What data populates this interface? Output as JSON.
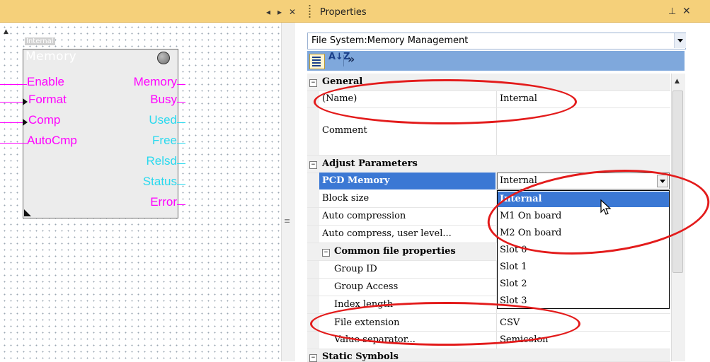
{
  "editor": {
    "controls": {
      "left": "◂",
      "right": "▸",
      "close": "✕"
    },
    "block": {
      "instance": "Internal",
      "type": "Memory",
      "inputs": [
        "Enable",
        "Format",
        "Comp",
        "AutoCmp"
      ],
      "outputs_magenta": [
        "Memory",
        "Busy"
      ],
      "outputs_cyan": [
        "Used",
        "Free",
        "Relsd",
        "Status"
      ],
      "outputs_error": "Error"
    }
  },
  "properties": {
    "title": "Properties",
    "pin": "⊥",
    "close": "✕",
    "selector": "File System:Memory Management",
    "toolbar": {
      "alpha": "A↓Z",
      "more": "»"
    },
    "categories": {
      "general": "General",
      "adjust": "Adjust Parameters",
      "common": "Common file properties",
      "static": "Static Symbols"
    },
    "rows": {
      "name_label": "(Name)",
      "name_value": "Internal",
      "comment_label": "Comment",
      "pcd_label": "PCD Memory",
      "pcd_value": "Internal",
      "block_label": "Block size",
      "auto_label": "Auto compression",
      "autouser_label": "Auto compress, user level...",
      "group_id_label": "Group ID",
      "group_access_label": "Group Access",
      "index_label": "Index length",
      "ext_label": "File extension",
      "ext_value": "CSV",
      "sep_label": "Value separator...",
      "sep_value": "Semicolon"
    },
    "dropdown": [
      "Internal",
      "M1 On board",
      "M2 On board",
      "Slot 0",
      "Slot 1",
      "Slot 2",
      "Slot 3"
    ],
    "dropdown_selected": "Internal"
  },
  "colors": {
    "highlight": "#3b78d4",
    "annotation": "#e31b1b",
    "titlebar": "#f5d07a"
  }
}
